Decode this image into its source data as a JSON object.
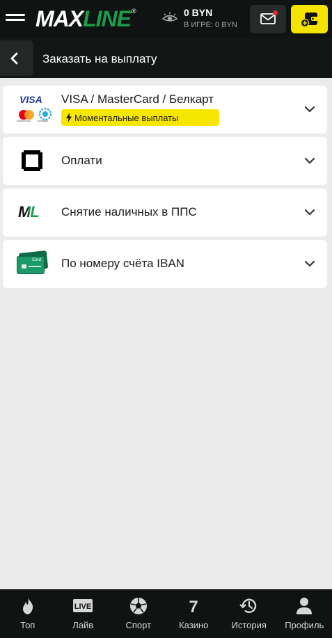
{
  "header": {
    "logo_max": "MAX",
    "logo_line": "LINE",
    "logo_reg": "®",
    "balance": "0 BYN",
    "in_game": "В ИГРЕ: 0 BYN",
    "icons": {
      "menu": "hamburger-icon",
      "balance": "eye-icon",
      "mail": "mail-icon",
      "deposit": "wallet-plus-icon"
    },
    "colors": {
      "brand_green": "#1d9b4d",
      "accent_yellow": "#f5e400",
      "notification": "#e82a2a"
    }
  },
  "page": {
    "title": "Заказать на выплату"
  },
  "methods": [
    {
      "title": "VISA / MasterCard / Белкарт",
      "badge": "Моментальные выплаты",
      "logo_visa": "VISA",
      "caption_mc": "mastercard",
      "caption_belkart": "Белкарт",
      "icon": "cards-icon"
    },
    {
      "title": "Оплати",
      "icon": "oplati-icon"
    },
    {
      "title": "Снятие наличных в ППС",
      "icon": "ml-logo-icon",
      "logo_text": "ML"
    },
    {
      "title": "По номеру счёта IBAN",
      "icon": "bank-card-icon",
      "card_label": "Card"
    }
  ],
  "bottom_nav": [
    {
      "label": "Топ",
      "icon": "flame-icon"
    },
    {
      "label": "Лайв",
      "icon": "live-icon",
      "icon_text": "LIVE"
    },
    {
      "label": "Спорт",
      "icon": "soccer-ball-icon"
    },
    {
      "label": "Казино",
      "icon": "slot-seven-icon",
      "icon_text": "7"
    },
    {
      "label": "История",
      "icon": "history-icon"
    },
    {
      "label": "Профиль",
      "icon": "user-icon"
    }
  ]
}
